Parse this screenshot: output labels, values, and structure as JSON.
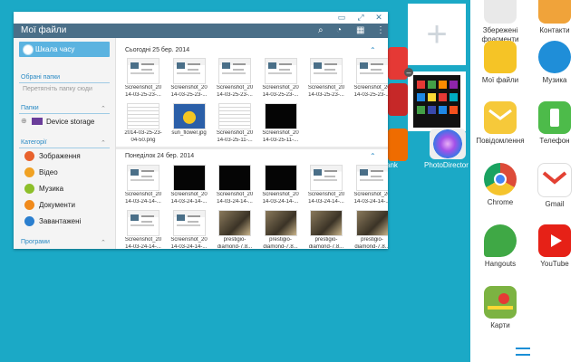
{
  "file_window": {
    "title": "Мої файли",
    "timeline_label": "Шкала часу",
    "favorites_header": "Обрані папки",
    "favorites_hint": "Перетягніть папку сюди",
    "folders_header": "Папки",
    "device_storage": "Device storage",
    "categories_header": "Категорії",
    "categories": [
      {
        "label": "Зображення",
        "color": "#e8622d"
      },
      {
        "label": "Відео",
        "color": "#f0a224"
      },
      {
        "label": "Музика",
        "color": "#8dbf2a"
      },
      {
        "label": "Документи",
        "color": "#f08a1c"
      },
      {
        "label": "Завантажені",
        "color": "#2b7fcf"
      }
    ],
    "programs_header": "Програми",
    "groups": [
      {
        "date": "Сьогодні  25 бер. 2014",
        "files": [
          [
            "Screenshot_20",
            "14-03-25-23-..."
          ],
          [
            "Screenshot_20",
            "14-03-25-23-..."
          ],
          [
            "Screenshot_20",
            "14-03-25-23-..."
          ],
          [
            "Screenshot_20",
            "14-03-25-23-..."
          ],
          [
            "Screenshot_20",
            "14-03-25-23-..."
          ],
          [
            "Screenshot_20",
            "14-03-25-23-..."
          ],
          [
            "2014-03-25-23-",
            "04-50.png"
          ],
          [
            "sun_flower.jpg",
            ""
          ],
          [
            "Screenshot_20",
            "14-03-25-11-..."
          ],
          [
            "Screenshot_20",
            "14-03-25-11-..."
          ]
        ]
      },
      {
        "date": "Понеділок  24 бер. 2014",
        "files": [
          [
            "Screenshot_20",
            "14-03-24-14-..."
          ],
          [
            "Screenshot_20",
            "14-03-24-14-..."
          ],
          [
            "Screenshot_20",
            "14-03-24-14-..."
          ],
          [
            "Screenshot_20",
            "14-03-24-14-..."
          ],
          [
            "Screenshot_20",
            "14-03-24-14-..."
          ],
          [
            "Screenshot_20",
            "14-03-24-14-..."
          ],
          [
            "Screenshot_20",
            "14-03-24-14-..."
          ],
          [
            "Screenshot_20",
            "14-03-24-14-..."
          ],
          [
            "prestigio-",
            "diamond-7.8..."
          ],
          [
            "prestigio-",
            "diamond-7.8..."
          ],
          [
            "prestigio-",
            "diamond-7.8..."
          ],
          [
            "prestigio-",
            "diamond-7.8..."
          ]
        ]
      }
    ]
  },
  "background": {
    "partial_labels": [
      "ank",
      "PhotoDirector"
    ]
  },
  "side_panel": {
    "apps": [
      {
        "label": "Збережені фрагменти",
        "lines": [
          "Збережені",
          "фрагменти"
        ],
        "icon": "scrapbook-icon",
        "color": "#e9e9e9"
      },
      {
        "label": "Контакти",
        "lines": [
          "Контакти"
        ],
        "icon": "contacts-icon",
        "color": "#f0a33a"
      },
      {
        "label": "Мої файли",
        "lines": [
          "Мої файли"
        ],
        "icon": "folder-icon",
        "color": "#f5c426"
      },
      {
        "label": "Музика",
        "lines": [
          "Музика"
        ],
        "icon": "music-icon",
        "color": "#1f8ed8"
      },
      {
        "label": "Повідомлення",
        "lines": [
          "Повідомлення"
        ],
        "icon": "messages-icon",
        "color": "#f6c93a"
      },
      {
        "label": "Телефон",
        "lines": [
          "Телефон"
        ],
        "icon": "phone-icon",
        "color": "#4dbb4a"
      },
      {
        "label": "Chrome",
        "lines": [
          "Chrome"
        ],
        "icon": "chrome-icon",
        "color": "#dd4b39"
      },
      {
        "label": "Gmail",
        "lines": [
          "Gmail"
        ],
        "icon": "gmail-icon",
        "color": "#e34133"
      },
      {
        "label": "Hangouts",
        "lines": [
          "Hangouts"
        ],
        "icon": "hangouts-icon",
        "color": "#3fa845"
      },
      {
        "label": "YouTube",
        "lines": [
          "YouTube"
        ],
        "icon": "youtube-icon",
        "color": "#e62117"
      },
      {
        "label": "Карти",
        "lines": [
          "Карти"
        ],
        "icon": "maps-icon",
        "color": "#7cb342"
      }
    ]
  }
}
